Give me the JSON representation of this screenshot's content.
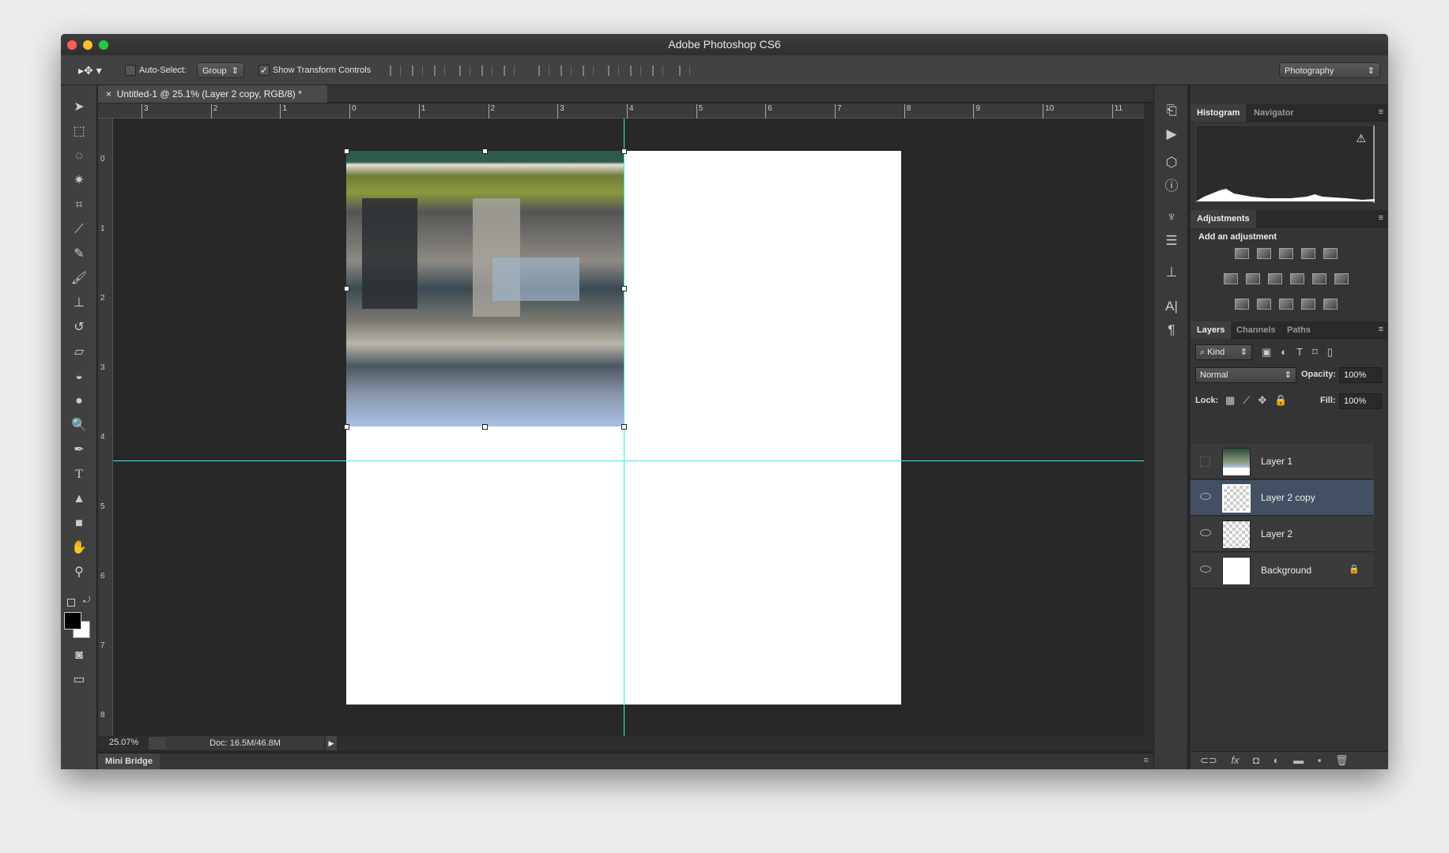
{
  "window": {
    "title": "Adobe Photoshop CS6"
  },
  "options_bar": {
    "auto_select_label": "Auto-Select:",
    "auto_select_checked": false,
    "auto_select_mode": "Group",
    "show_transform_label": "Show Transform Controls",
    "show_transform_checked": true,
    "workspace": "Photography"
  },
  "document": {
    "tab_title": "Untitled-1 @ 25.1% (Layer 2 copy, RGB/8) *",
    "close": "×"
  },
  "rulers": {
    "horizontal": [
      "3",
      "2",
      "1",
      "0",
      "1",
      "2",
      "3",
      "4",
      "5",
      "6",
      "7",
      "8",
      "9",
      "10",
      "11"
    ],
    "vertical": [
      "0",
      "1",
      "2",
      "3",
      "4",
      "5",
      "6",
      "7",
      "8"
    ]
  },
  "status": {
    "zoom": "25.07%",
    "doc_size": "Doc: 16.5M/46.8M"
  },
  "mini_bridge": "Mini Bridge",
  "panels": {
    "top_tabs": [
      "Histogram",
      "Navigator"
    ],
    "adjustments": {
      "tab": "Adjustments",
      "heading": "Add an adjustment"
    },
    "layers_tabs": [
      "Layers",
      "Channels",
      "Paths"
    ],
    "filter_kind": "Kind",
    "blend_mode": "Normal",
    "opacity_label": "Opacity:",
    "opacity": "100%",
    "lock_label": "Lock:",
    "fill_label": "Fill:",
    "fill": "100%",
    "layers": [
      {
        "name": "Layer 1",
        "visible": false,
        "selected": false
      },
      {
        "name": "Layer 2 copy",
        "visible": true,
        "selected": true
      },
      {
        "name": "Layer 2",
        "visible": true,
        "selected": false
      },
      {
        "name": "Background",
        "visible": true,
        "selected": false,
        "locked": true
      }
    ]
  },
  "colors": {
    "guide": "#33eeee",
    "selection": "#435064",
    "foreground": "#000000",
    "background": "#ffffff"
  }
}
